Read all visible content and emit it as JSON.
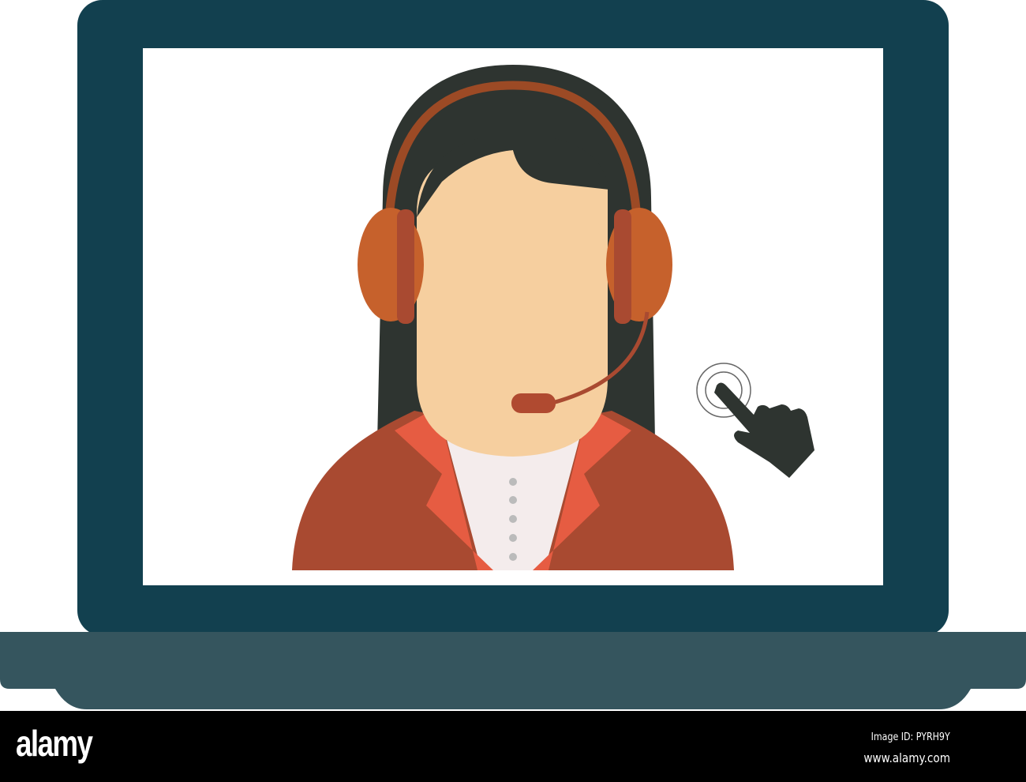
{
  "illustration": {
    "subject": "customer-support-agent-on-laptop",
    "colors": {
      "laptop_lid": "#12404f",
      "laptop_base": "#35555e",
      "screen": "#ffffff",
      "hair": "#2e3430",
      "skin": "#f6cf9f",
      "headphones": "#c6612c",
      "headband": "#9c4a25",
      "jacket": "#a94a31",
      "lapel": "#e65c42",
      "shirt": "#f4ecec",
      "hand": "#2e3430"
    },
    "watermark": "alamy"
  },
  "footer": {
    "logo": "alamy",
    "image_id": "Image ID: PYRH9Y",
    "website": "www.alamy.com"
  }
}
